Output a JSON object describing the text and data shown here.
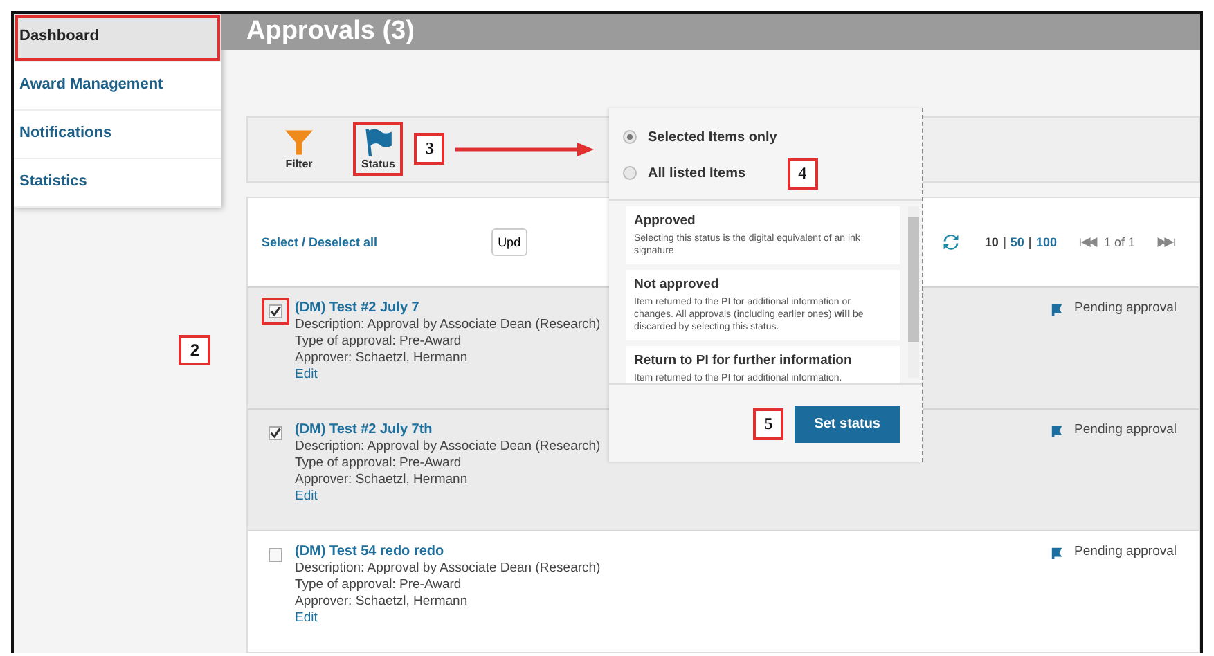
{
  "sidebar": {
    "items": [
      {
        "label": "Dashboard",
        "selected": true,
        "highlighted": true
      },
      {
        "label": "Award Management",
        "selected": false,
        "highlighted": false
      },
      {
        "label": "Notifications",
        "selected": false,
        "highlighted": false
      },
      {
        "label": "Statistics",
        "selected": false,
        "highlighted": false
      }
    ]
  },
  "header": {
    "title": "Approvals (3)"
  },
  "toolbar": {
    "tools": [
      {
        "label": "Filter",
        "kind": "filter",
        "highlighted": false
      },
      {
        "label": "Status",
        "kind": "status",
        "highlighted": true
      }
    ]
  },
  "list": {
    "select_all": "Select / Deselect all",
    "update_button": "Upd",
    "page_size_separator": "|",
    "page_sizes": [
      {
        "label": "10",
        "selected": true
      },
      {
        "label": "50",
        "selected": false
      },
      {
        "label": "100",
        "selected": false
      }
    ],
    "page_info": "1 of 1",
    "rows": [
      {
        "title": "(DM) Test #2 July 7",
        "description": "Description: Approval by Associate Dean (Research)",
        "type": "Type of approval: Pre-Award",
        "approver": "Approver: Schaetzl, Hermann",
        "edit": "Edit",
        "status": "Pending approval",
        "checked": true,
        "highlighted": true
      },
      {
        "title": "(DM) Test #2 July 7th",
        "description": "Description: Approval by Associate Dean (Research)",
        "type": "Type of approval: Pre-Award",
        "approver": "Approver: Schaetzl, Hermann",
        "edit": "Edit",
        "status": "Pending approval",
        "checked": true,
        "highlighted": false
      },
      {
        "title": "(DM) Test 54 redo redo",
        "description": "Description: Approval by Associate Dean (Research)",
        "type": "Type of approval: Pre-Award",
        "approver": "Approver: Schaetzl, Hermann",
        "edit": "Edit",
        "status": "Pending approval",
        "checked": false,
        "highlighted": false
      }
    ]
  },
  "status_popup": {
    "scope_options": [
      {
        "label": "Selected Items only",
        "selected": true
      },
      {
        "label": "All listed Items",
        "selected": false
      }
    ],
    "statuses": [
      {
        "name": "Approved",
        "description": "Selecting this status is the digital equivalent of an ink signature"
      },
      {
        "name": "Not approved",
        "description": "Item returned to the PI for additional information or changes. All approvals (including earlier ones) **will** be discarded by selecting this status."
      },
      {
        "name": "Return to PI for further information",
        "description": "Item returned to the PI for additional information."
      }
    ],
    "button": "Set status"
  },
  "annotations": {
    "row_callout": "2",
    "status_callout": "3",
    "scope_callout": "4",
    "button_callout": "5"
  }
}
